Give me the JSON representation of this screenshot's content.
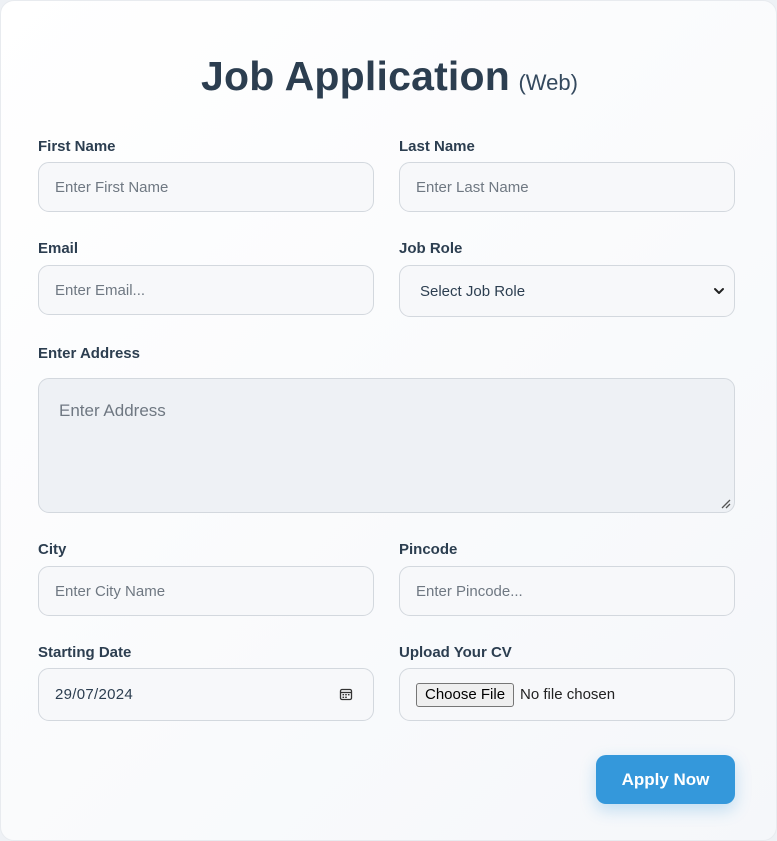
{
  "header": {
    "title": "Job Application",
    "subtitle": "(Web)"
  },
  "form": {
    "first_name": {
      "label": "First Name",
      "placeholder": "Enter First Name",
      "value": ""
    },
    "last_name": {
      "label": "Last Name",
      "placeholder": "Enter Last Name",
      "value": ""
    },
    "email": {
      "label": "Email",
      "placeholder": "Enter Email...",
      "value": ""
    },
    "job_role": {
      "label": "Job Role",
      "selected": "Select Job Role",
      "icon": "chevron-down-icon"
    },
    "address": {
      "label": "Enter Address",
      "placeholder": "Enter Address",
      "value": ""
    },
    "city": {
      "label": "City",
      "placeholder": "Enter City Name",
      "value": ""
    },
    "pincode": {
      "label": "Pincode",
      "placeholder": "Enter Pincode...",
      "value": ""
    },
    "starting_date": {
      "label": "Starting Date",
      "value": "29/07/2024",
      "icon": "calendar-icon"
    },
    "cv": {
      "label": "Upload Your CV",
      "button_label": "Choose File",
      "status": "No file chosen"
    },
    "submit": {
      "label": "Apply Now"
    }
  },
  "colors": {
    "accent": "#3498db",
    "text": "#2c3e50",
    "input_bg": "#f7f8fa",
    "input_border": "#d3d8de"
  }
}
